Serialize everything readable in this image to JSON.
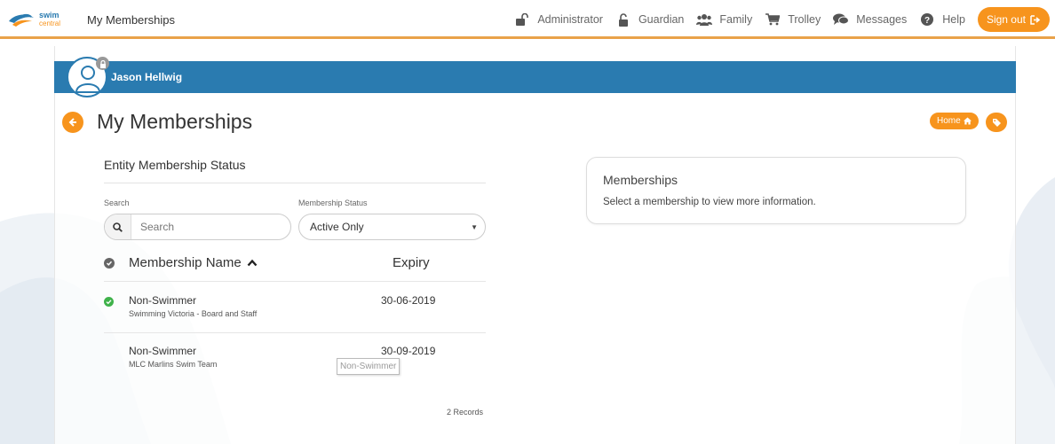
{
  "header": {
    "logo_text": "swim",
    "logo_sub": "central",
    "app_title": "My Memberships",
    "nav": [
      {
        "label": "Administrator",
        "icon": "unlock-icon"
      },
      {
        "label": "Guardian",
        "icon": "unlock-icon"
      },
      {
        "label": "Family",
        "icon": "users-icon"
      },
      {
        "label": "Trolley",
        "icon": "cart-icon"
      },
      {
        "label": "Messages",
        "icon": "comments-icon"
      },
      {
        "label": "Help",
        "icon": "question-circle-icon"
      }
    ],
    "sign_out_label": "Sign out"
  },
  "profile": {
    "name": "Jason Hellwig"
  },
  "page": {
    "title": "My Memberships",
    "home_label": "Home"
  },
  "filters": {
    "section_title": "Entity Membership Status",
    "search_label": "Search",
    "search_placeholder": "Search",
    "status_label": "Membership Status",
    "status_value": "Active Only"
  },
  "table": {
    "col_name": "Membership Name",
    "col_expiry": "Expiry",
    "rows": [
      {
        "name": "Non-Swimmer",
        "entity": "Swimming Victoria - Board and Staff",
        "expiry": "30-06-2019",
        "active": true
      },
      {
        "name": "Non-Swimmer",
        "entity": "MLC Marlins Swim Team",
        "expiry": "30-09-2019",
        "active": false
      }
    ],
    "records_text": "2 Records",
    "tooltip": "Non-Swimmer"
  },
  "info_panel": {
    "title": "Memberships",
    "text": "Select a membership to view more information."
  },
  "colors": {
    "accent_orange": "#f7941d",
    "profile_blue": "#2a7bb0",
    "active_green": "#3fb24a"
  }
}
